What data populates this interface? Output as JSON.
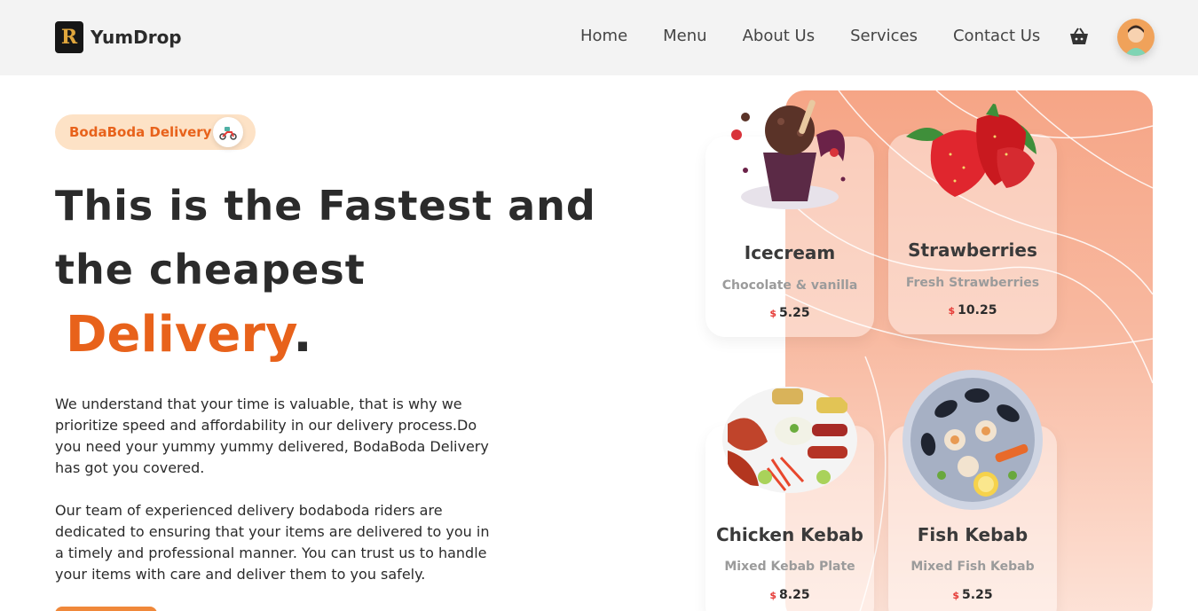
{
  "brand": {
    "name": "YumDrop",
    "logo_letter": "R"
  },
  "nav": [
    "Home",
    "Menu",
    "About Us",
    "Services",
    "Contact Us"
  ],
  "header_icons": {
    "cart": "basket-icon",
    "profile": "user-avatar"
  },
  "hero": {
    "badge": "BodaBoda Delivery",
    "badge_icon": "scooter-icon",
    "title_line1": "This is the Fastest and",
    "title_line2": "the cheapest",
    "accent": "Delivery",
    "accent_suffix": ".",
    "paragraph1": "We understand that your time is valuable, that is why we prioritize speed and affordability in our delivery process.Do you need your yummy yummy delivered, BodaBoda Delivery has got you covered.",
    "paragraph2": "Our team of experienced delivery bodaboda riders are dedicated to ensuring that your items are delivered to you in a timely and professional manner. You can trust us to handle your items with care and deliver them to you safely."
  },
  "cards": [
    {
      "title": "Icecream",
      "subtitle": "Chocolate & vanilla",
      "currency": "$",
      "price": "5.25"
    },
    {
      "title": "Strawberries",
      "subtitle": "Fresh Strawberries",
      "currency": "$",
      "price": "10.25"
    },
    {
      "title": "Chicken Kebab",
      "subtitle": "Mixed Kebab Plate",
      "currency": "$",
      "price": "8.25"
    },
    {
      "title": "Fish Kebab",
      "subtitle": "Mixed Fish Kebab",
      "currency": "$",
      "price": "5.25"
    }
  ],
  "colors": {
    "accent": "#e8621b",
    "badge_bg": "#fde2c6",
    "panel_top": "#f6a586",
    "price_currency": "#e53935"
  }
}
